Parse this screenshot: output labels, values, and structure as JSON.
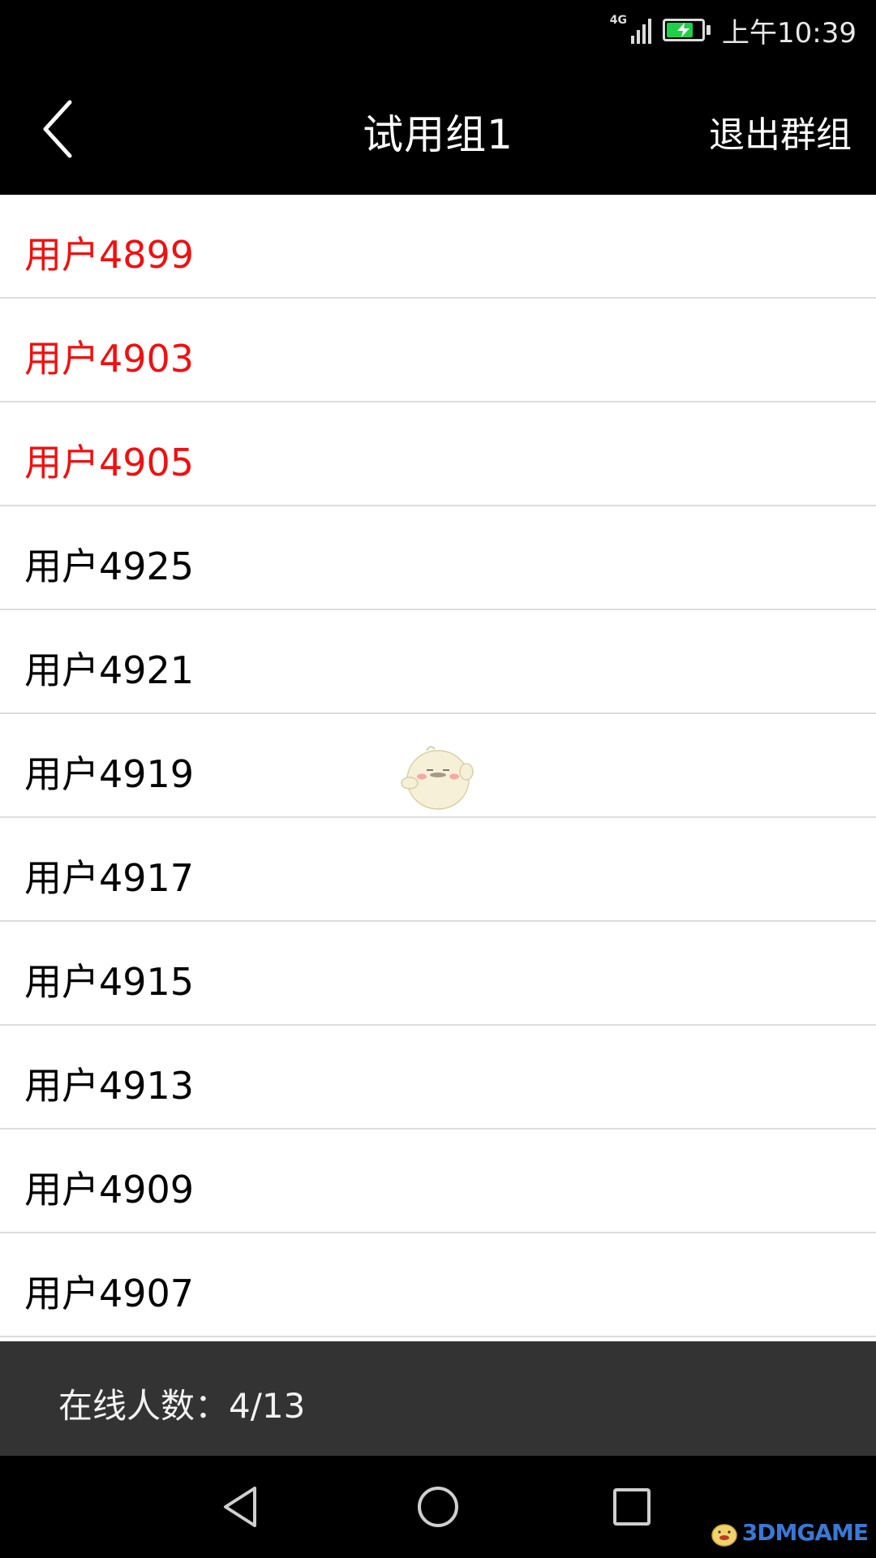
{
  "status_bar": {
    "network": "4G",
    "time": "上午10:39",
    "battery_color": "#1fcf4a"
  },
  "header": {
    "back_icon": "chevron-left-icon",
    "title": "试用组1",
    "exit_label": "退出群组"
  },
  "members": [
    {
      "name": "用户4899",
      "online": true
    },
    {
      "name": "用户4903",
      "online": true
    },
    {
      "name": "用户4905",
      "online": true
    },
    {
      "name": "用户4925",
      "online": false
    },
    {
      "name": "用户4921",
      "online": false
    },
    {
      "name": "用户4919",
      "online": false
    },
    {
      "name": "用户4917",
      "online": false
    },
    {
      "name": "用户4915",
      "online": false
    },
    {
      "name": "用户4913",
      "online": false
    },
    {
      "name": "用户4909",
      "online": false
    },
    {
      "name": "用户4907",
      "online": false
    }
  ],
  "colors": {
    "online_name": "#f01010",
    "offline_name": "#000000",
    "header_bg": "#000000",
    "footer_bg": "#333333"
  },
  "footer": {
    "online_count": "在线人数：4/13"
  },
  "nav_bar": {
    "back_icon": "triangle-back-icon",
    "home_icon": "circle-home-icon",
    "recent_icon": "square-recent-icon"
  },
  "watermark": {
    "text": "3DMGAME"
  }
}
